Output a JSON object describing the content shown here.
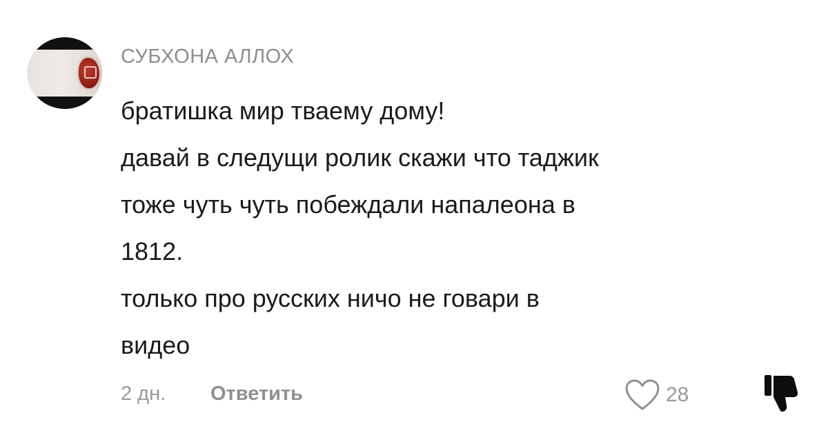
{
  "comment": {
    "author": "СУБХОНА АЛЛОХ",
    "lines": [
      "братишка мир тваему дому!",
      "давай в следущи ролик скажи что таджик",
      "тоже чуть чуть побеждали напалеона в",
      "1812.",
      "только про русских ничо не говари в",
      "видео"
    ],
    "timestamp": "2 дн.",
    "reply_label": "Ответить",
    "like_count": "28",
    "icons": {
      "like": "heart-outline-icon",
      "dislike": "thumbs-down-icon"
    },
    "colors": {
      "text": "#1a1a1a",
      "muted": "#9a9a9a",
      "avatar_heart": "#a52a1f"
    }
  }
}
